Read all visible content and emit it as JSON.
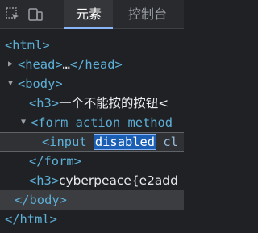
{
  "tabs": {
    "elements": "元素",
    "console": "控制台"
  },
  "dom": {
    "html_open": "<html>",
    "head_open": "<head>",
    "head_ellipsis": "…",
    "head_close": "</head>",
    "body_open": "<body>",
    "h3_open": "<h3>",
    "h3_text": "一个不能按的按钮<",
    "form_open": "<form action method",
    "input_open": "<input",
    "input_attr_selected": "disabled",
    "input_rest": "cl",
    "form_close": "</form>",
    "h3_flag_open": "<h3>",
    "h3_flag_text": "cyberpeace{e2add",
    "body_close": "</body>",
    "html_close": "</html>"
  },
  "colors": {
    "background": "#202124",
    "tab_active": "#8ab4f8",
    "tag": "#5db0d7",
    "selection": "#1a5fb4"
  }
}
